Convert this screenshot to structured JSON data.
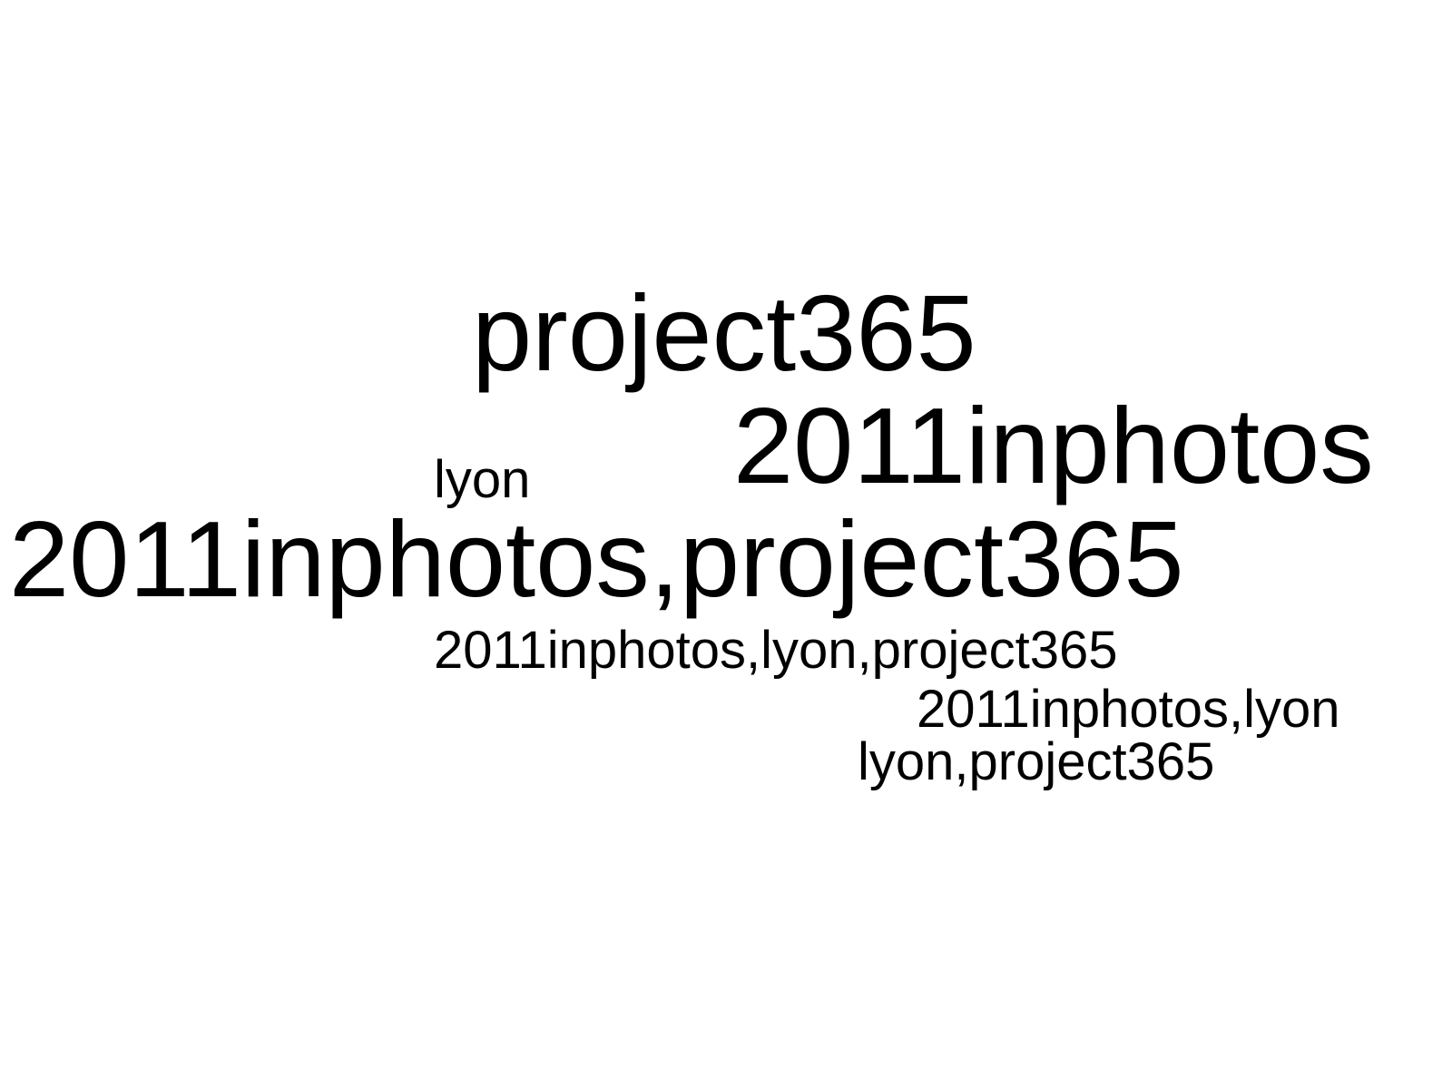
{
  "tag_cloud": {
    "words": [
      {
        "text": "project365",
        "size_rank": "large"
      },
      {
        "text": "2011inphotos",
        "size_rank": "large"
      },
      {
        "text": "lyon",
        "size_rank": "small"
      },
      {
        "text": "2011inphotos,project365",
        "size_rank": "large"
      },
      {
        "text": "2011inphotos,lyon,project365",
        "size_rank": "small"
      },
      {
        "text": "2011inphotos,lyon",
        "size_rank": "small"
      },
      {
        "text": "lyon,project365",
        "size_rank": "small"
      }
    ],
    "text_color": "#000000",
    "background_color": "#ffffff"
  }
}
